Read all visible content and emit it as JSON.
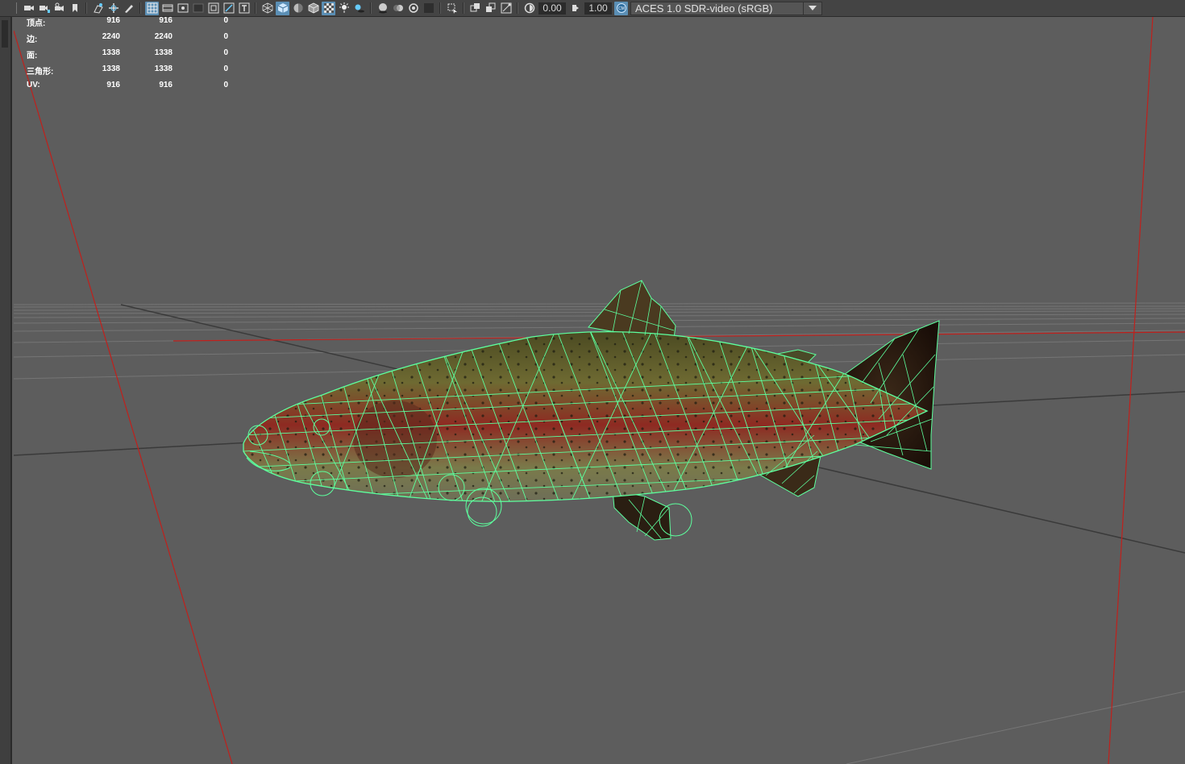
{
  "toolbar": {
    "exposure_value": "0.00",
    "gamma_value": "1.00",
    "color_space": "ACES 1.0 SDR-video (sRGB)",
    "icons": [
      "camera-icon",
      "camera-attributes-icon",
      "bookmark-icon",
      "image-plane-icon",
      "2d-pan-icon",
      "grease-pencil-icon",
      "grid-icon",
      "film-gate-icon",
      "resolution-gate-icon",
      "gate-mask-icon",
      "field-chart-icon",
      "safe-action-icon",
      "safe-title-icon",
      "wireframe-icon",
      "smooth-shade-icon",
      "default-material-icon",
      "wireframe-on-shaded-icon",
      "textured-icon",
      "use-all-lights-icon",
      "shadows-icon",
      "screen-space-ao-icon",
      "motion-blur-icon",
      "anti-aliasing-icon",
      "depth-of-field-icon",
      "isolate-select-icon",
      "xray-icon",
      "xray-active-icon",
      "xray-joints-icon",
      "exposure-icon",
      "gamma-icon",
      "color-management-icon"
    ]
  },
  "hud": {
    "rows": [
      {
        "label": "顶点:",
        "v1": "916",
        "v2": "916",
        "v3": "0"
      },
      {
        "label": "边:",
        "v1": "2240",
        "v2": "2240",
        "v3": "0"
      },
      {
        "label": "面:",
        "v1": "1338",
        "v2": "1338",
        "v3": "0"
      },
      {
        "label": "三角形:",
        "v1": "1338",
        "v2": "1338",
        "v3": "0"
      },
      {
        "label": "UV:",
        "v1": "916",
        "v2": "916",
        "v3": "0"
      }
    ]
  },
  "colors": {
    "viewport_bg": "#5d5d5d",
    "wireframe": "#5dff9e",
    "axis_red": "#c0201c",
    "active_button": "#5b8fb5"
  }
}
